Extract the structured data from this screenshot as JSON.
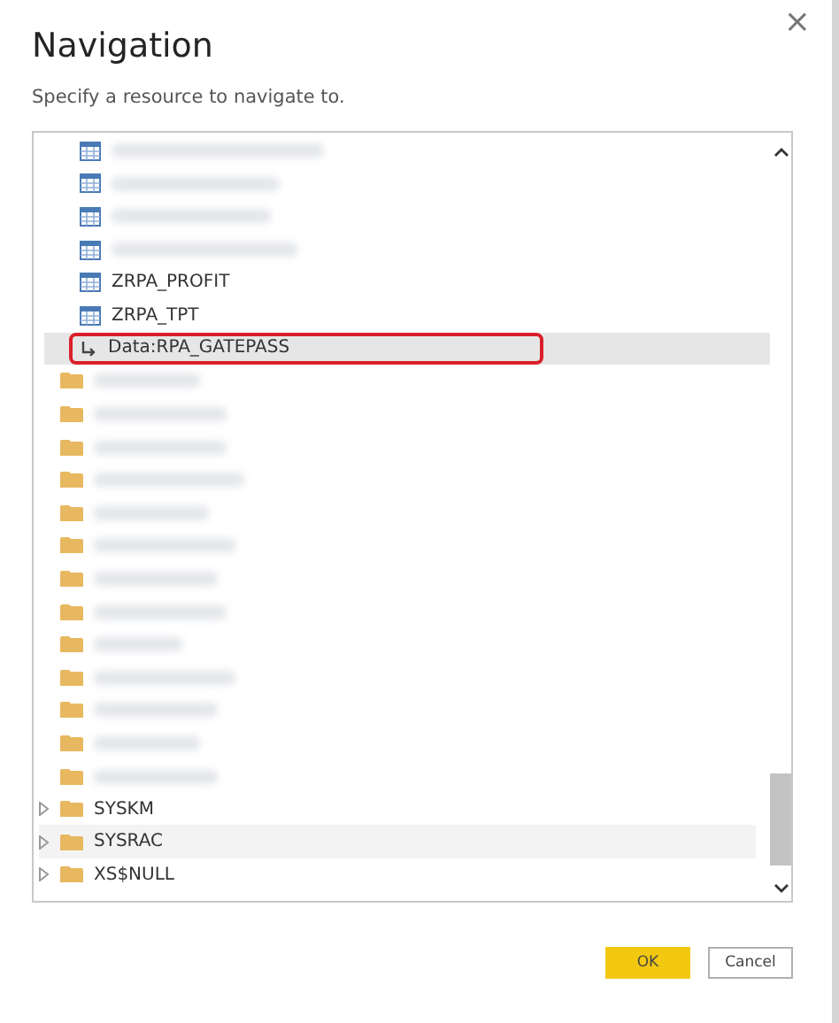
{
  "dialog": {
    "title": "Navigation",
    "subtitle": "Specify a resource to navigate to.",
    "close": "×"
  },
  "tree": {
    "items": [
      {
        "kind": "blurred-table",
        "selected": false,
        "hovered": false,
        "outlined": false
      },
      {
        "kind": "blurred-table",
        "selected": false,
        "hovered": false,
        "outlined": false
      },
      {
        "kind": "blurred-table",
        "selected": false,
        "hovered": false,
        "outlined": false
      },
      {
        "kind": "blurred-table",
        "selected": false,
        "hovered": false,
        "outlined": false
      },
      {
        "kind": "table",
        "label": "ZRPA_PROFIT",
        "selected": false,
        "hovered": false,
        "outlined": false
      },
      {
        "kind": "table",
        "label": "ZRPA_TPT",
        "selected": false,
        "hovered": false,
        "outlined": false
      },
      {
        "kind": "link",
        "label": "Data:RPA_GATEPASS",
        "selected": true,
        "hovered": false,
        "outlined": true
      },
      {
        "kind": "blurred-folder",
        "selected": false,
        "hovered": false,
        "outlined": false
      },
      {
        "kind": "blurred-folder",
        "selected": false,
        "hovered": false,
        "outlined": false
      },
      {
        "kind": "blurred-folder",
        "selected": false,
        "hovered": false,
        "outlined": false
      },
      {
        "kind": "blurred-folder",
        "selected": false,
        "hovered": false,
        "outlined": false
      },
      {
        "kind": "blurred-folder",
        "selected": false,
        "hovered": false,
        "outlined": false
      },
      {
        "kind": "blurred-folder",
        "selected": false,
        "hovered": false,
        "outlined": false
      },
      {
        "kind": "blurred-folder",
        "selected": false,
        "hovered": false,
        "outlined": false
      },
      {
        "kind": "blurred-folder",
        "selected": false,
        "hovered": false,
        "outlined": false
      },
      {
        "kind": "blurred-folder",
        "selected": false,
        "hovered": false,
        "outlined": false
      },
      {
        "kind": "blurred-folder",
        "selected": false,
        "hovered": false,
        "outlined": false
      },
      {
        "kind": "blurred-folder",
        "selected": false,
        "hovered": false,
        "outlined": false
      },
      {
        "kind": "blurred-folder",
        "selected": false,
        "hovered": false,
        "outlined": false
      },
      {
        "kind": "blurred-folder",
        "selected": false,
        "hovered": false,
        "outlined": false
      },
      {
        "kind": "folder",
        "label": "SYSKM",
        "expanded": false,
        "selected": false,
        "hovered": false,
        "outlined": false
      },
      {
        "kind": "folder",
        "label": "SYSRAC",
        "expanded": false,
        "selected": false,
        "hovered": true,
        "outlined": false
      },
      {
        "kind": "folder",
        "label": "XS$NULL",
        "expanded": false,
        "selected": false,
        "hovered": false,
        "outlined": false
      }
    ]
  },
  "buttons": [
    {
      "label": "OK",
      "kind": "primary"
    },
    {
      "label": "Cancel",
      "kind": "secondary"
    }
  ]
}
